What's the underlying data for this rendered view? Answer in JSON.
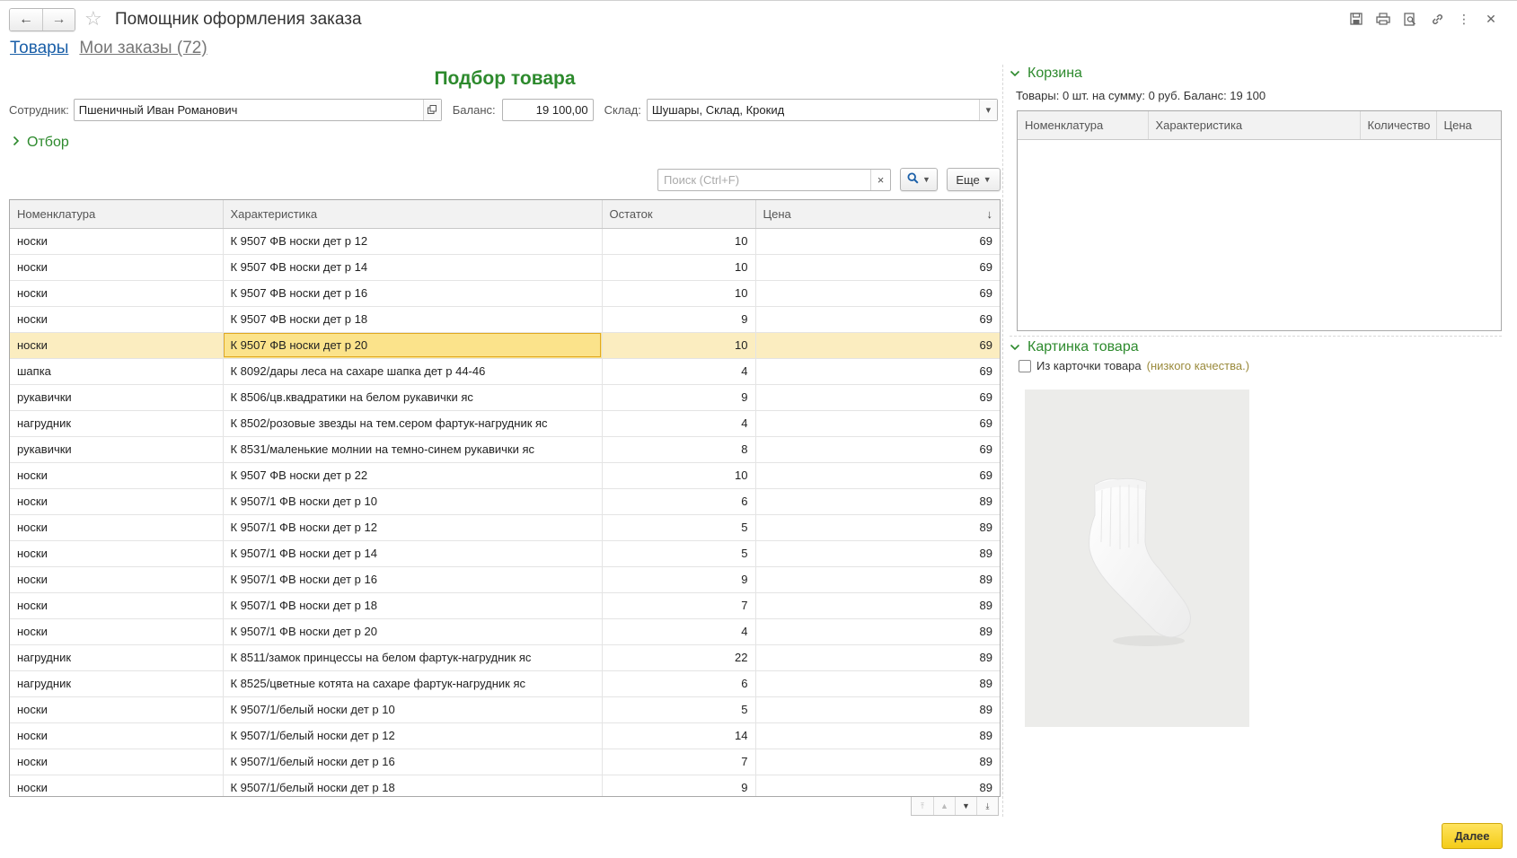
{
  "window": {
    "title": "Помощник оформления заказа"
  },
  "tabs": [
    {
      "label": "Товары"
    },
    {
      "label": "Мои заказы (72)"
    }
  ],
  "form": {
    "title": "Подбор товара",
    "employee_label": "Сотрудник:",
    "employee_value": "Пшеничный Иван Романович",
    "balance_label": "Баланс:",
    "balance_value": "19 100,00",
    "warehouse_label": "Склад:",
    "warehouse_value": "Шушары, Склад, Крокид",
    "filter_label": "Отбор"
  },
  "toolbar": {
    "search_placeholder": "Поиск (Ctrl+F)",
    "search_clear": "×",
    "more_label": "Еще"
  },
  "grid": {
    "columns": [
      "Номенклатура",
      "Характеристика",
      "Остаток",
      "Цена"
    ],
    "sort_indicator": "↓",
    "selected_row": 4,
    "rows": [
      {
        "name": "носки",
        "char": "К 9507 ФВ носки дет р 12",
        "stock": "10",
        "price": "69"
      },
      {
        "name": "носки",
        "char": "К 9507 ФВ носки дет р 14",
        "stock": "10",
        "price": "69"
      },
      {
        "name": "носки",
        "char": "К 9507 ФВ носки дет р 16",
        "stock": "10",
        "price": "69"
      },
      {
        "name": "носки",
        "char": "К 9507 ФВ носки дет р 18",
        "stock": "9",
        "price": "69"
      },
      {
        "name": "носки",
        "char": "К 9507 ФВ носки дет р 20",
        "stock": "10",
        "price": "69"
      },
      {
        "name": "шапка",
        "char": "К 8092/дары леса на сахаре шапка дет р 44-46",
        "stock": "4",
        "price": "69"
      },
      {
        "name": "рукавички",
        "char": "К 8506/цв.квадратики на белом рукавички яс",
        "stock": "9",
        "price": "69"
      },
      {
        "name": "нагрудник",
        "char": "К 8502/розовые звезды на тем.сером фартук-нагрудник яс",
        "stock": "4",
        "price": "69"
      },
      {
        "name": "рукавички",
        "char": "К 8531/маленькие молнии на темно-синем рукавички яс",
        "stock": "8",
        "price": "69"
      },
      {
        "name": "носки",
        "char": "К 9507 ФВ носки дет р 22",
        "stock": "10",
        "price": "69"
      },
      {
        "name": "носки",
        "char": "К 9507/1 ФВ носки дет р 10",
        "stock": "6",
        "price": "89"
      },
      {
        "name": "носки",
        "char": "К 9507/1 ФВ носки дет р 12",
        "stock": "5",
        "price": "89"
      },
      {
        "name": "носки",
        "char": "К 9507/1 ФВ носки дет р 14",
        "stock": "5",
        "price": "89"
      },
      {
        "name": "носки",
        "char": "К 9507/1 ФВ носки дет р 16",
        "stock": "9",
        "price": "89"
      },
      {
        "name": "носки",
        "char": "К 9507/1 ФВ носки дет р 18",
        "stock": "7",
        "price": "89"
      },
      {
        "name": "носки",
        "char": "К 9507/1 ФВ носки дет р 20",
        "stock": "4",
        "price": "89"
      },
      {
        "name": "нагрудник",
        "char": "К 8511/замок принцессы на белом фартук-нагрудник яс",
        "stock": "22",
        "price": "89"
      },
      {
        "name": "нагрудник",
        "char": "К 8525/цветные котята на сахаре фартук-нагрудник яс",
        "stock": "6",
        "price": "89"
      },
      {
        "name": "носки",
        "char": "К 9507/1/белый носки дет р 10",
        "stock": "5",
        "price": "89"
      },
      {
        "name": "носки",
        "char": "К 9507/1/белый носки дет р 12",
        "stock": "14",
        "price": "89"
      },
      {
        "name": "носки",
        "char": "К 9507/1/белый носки дет р 16",
        "stock": "7",
        "price": "89"
      },
      {
        "name": "носки",
        "char": "К 9507/1/белый носки дет р 18",
        "stock": "9",
        "price": "89"
      }
    ]
  },
  "cart": {
    "title": "Корзина",
    "summary": "Товары: 0 шт. на сумму: 0 руб. Баланс: 19 100",
    "columns": [
      "Номенклатура",
      "Характеристика",
      "Количество",
      "Цена"
    ]
  },
  "picture": {
    "title": "Картинка товара",
    "checkbox_label": "Из карточки товара",
    "checkbox_note": "(низкого качества.)",
    "checked": false
  },
  "footer": {
    "next_label": "Далее"
  },
  "colors": {
    "accent_green": "#2d8a2d",
    "link_blue": "#1a5fa8",
    "selected_row": "#fbedc0",
    "next_button": "#f4cc18"
  }
}
